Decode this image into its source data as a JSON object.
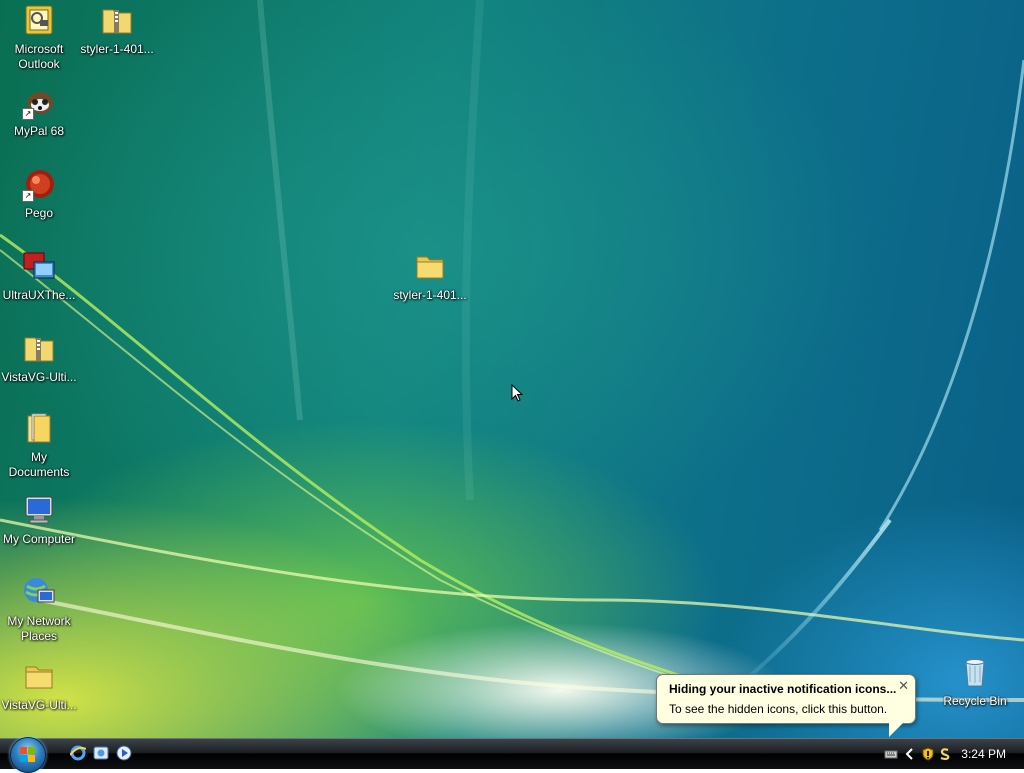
{
  "desktop": {
    "icons": {
      "outlook": {
        "label": "Microsoft\nOutlook",
        "icon": "outlook-icon"
      },
      "styler_zip_top": {
        "label": "styler-1-401...",
        "icon": "zip-folder-icon"
      },
      "mypal": {
        "label": "MyPal 68",
        "icon": "mypal-icon"
      },
      "pego": {
        "label": "Pego",
        "icon": "pego-icon"
      },
      "ultrauxtheme": {
        "label": "UltraUXThe...",
        "icon": "ultrauxtheme-icon"
      },
      "vistavg_zip": {
        "label": "VistaVG-Ulti...",
        "icon": "zip-folder-icon"
      },
      "my_documents": {
        "label": "My\nDocuments",
        "icon": "my-documents-icon"
      },
      "my_computer": {
        "label": "My Computer",
        "icon": "computer-icon"
      },
      "my_network": {
        "label": "My Network\nPlaces",
        "icon": "network-icon"
      },
      "vistavg_folder": {
        "label": "VistaVG-Ulti...",
        "icon": "folder-icon"
      },
      "styler_folder": {
        "label": "styler-1-401...",
        "icon": "folder-icon"
      },
      "recycle_bin": {
        "label": "Recycle Bin",
        "icon": "recycle-bin-icon"
      }
    }
  },
  "balloon": {
    "title": "Hiding your inactive notification icons...",
    "body": "To see the hidden icons, click this button.",
    "close": "✕"
  },
  "taskbar": {
    "clock": "3:24 PM",
    "quicklaunch": [
      "internet-explorer-icon",
      "show-desktop-icon",
      "media-player-icon"
    ],
    "tray": [
      "keyboard-icon",
      "show-hidden-icons-chevron",
      "security-shield-icon",
      "notification-s-icon"
    ]
  },
  "colors": {
    "balloon_bg": "#ffffe1",
    "taskbar": "#1c2024"
  }
}
